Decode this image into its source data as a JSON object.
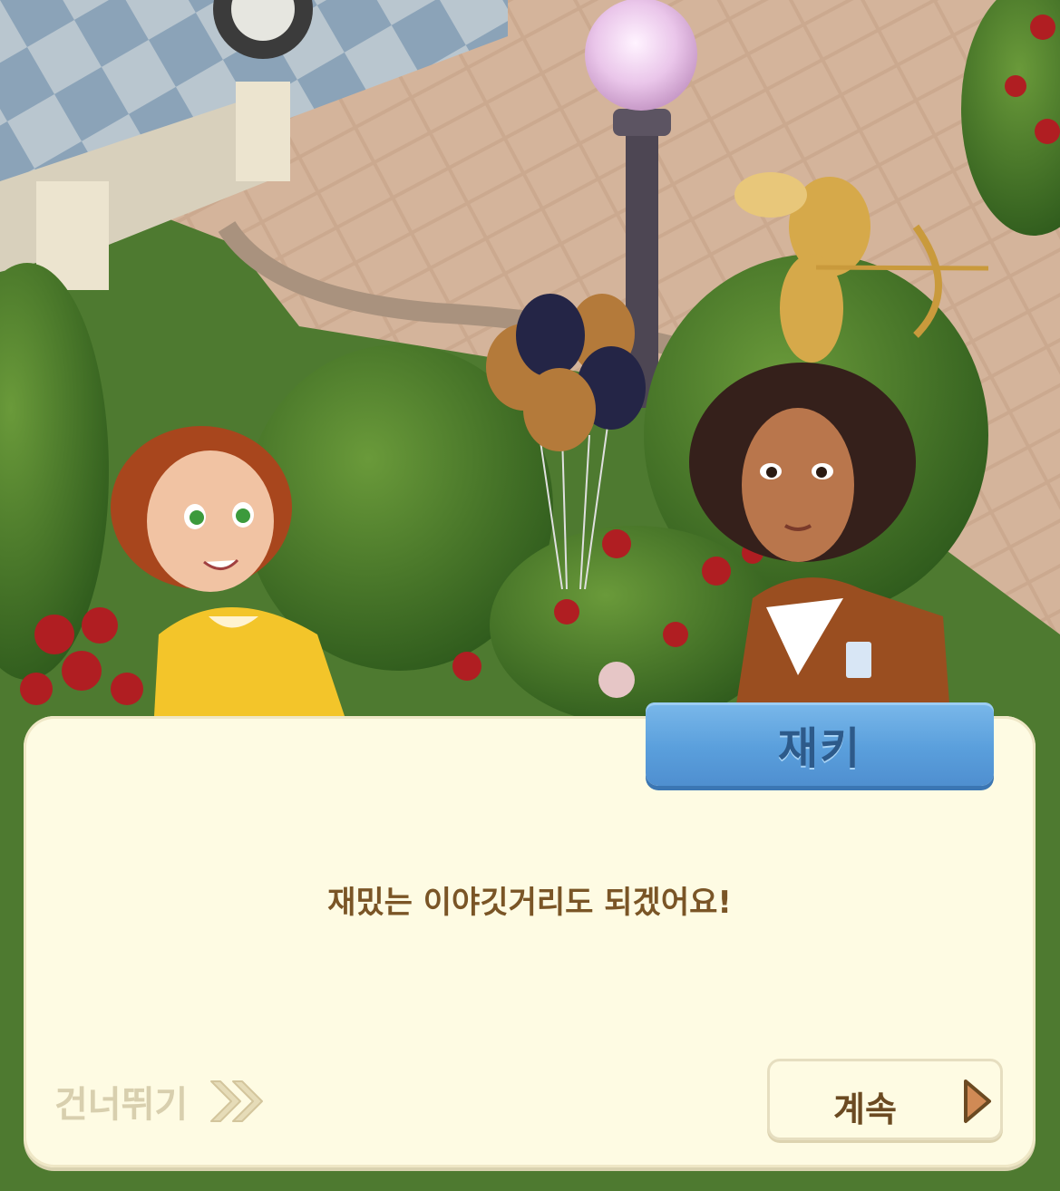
{
  "dialog": {
    "speaker": "재키",
    "line": "재밌는 이야깃거리도 되겠어요!",
    "skip_label": "건너뛰기",
    "continue_label": "계속"
  },
  "colors": {
    "panel": "#fefbe3",
    "name_tab": "#5a9fdc",
    "dialog_text": "#7a5526",
    "skip_text": "#d8cfae"
  },
  "icons": {
    "skip": "double-chevron-right-icon",
    "continue": "play-triangle-icon"
  }
}
